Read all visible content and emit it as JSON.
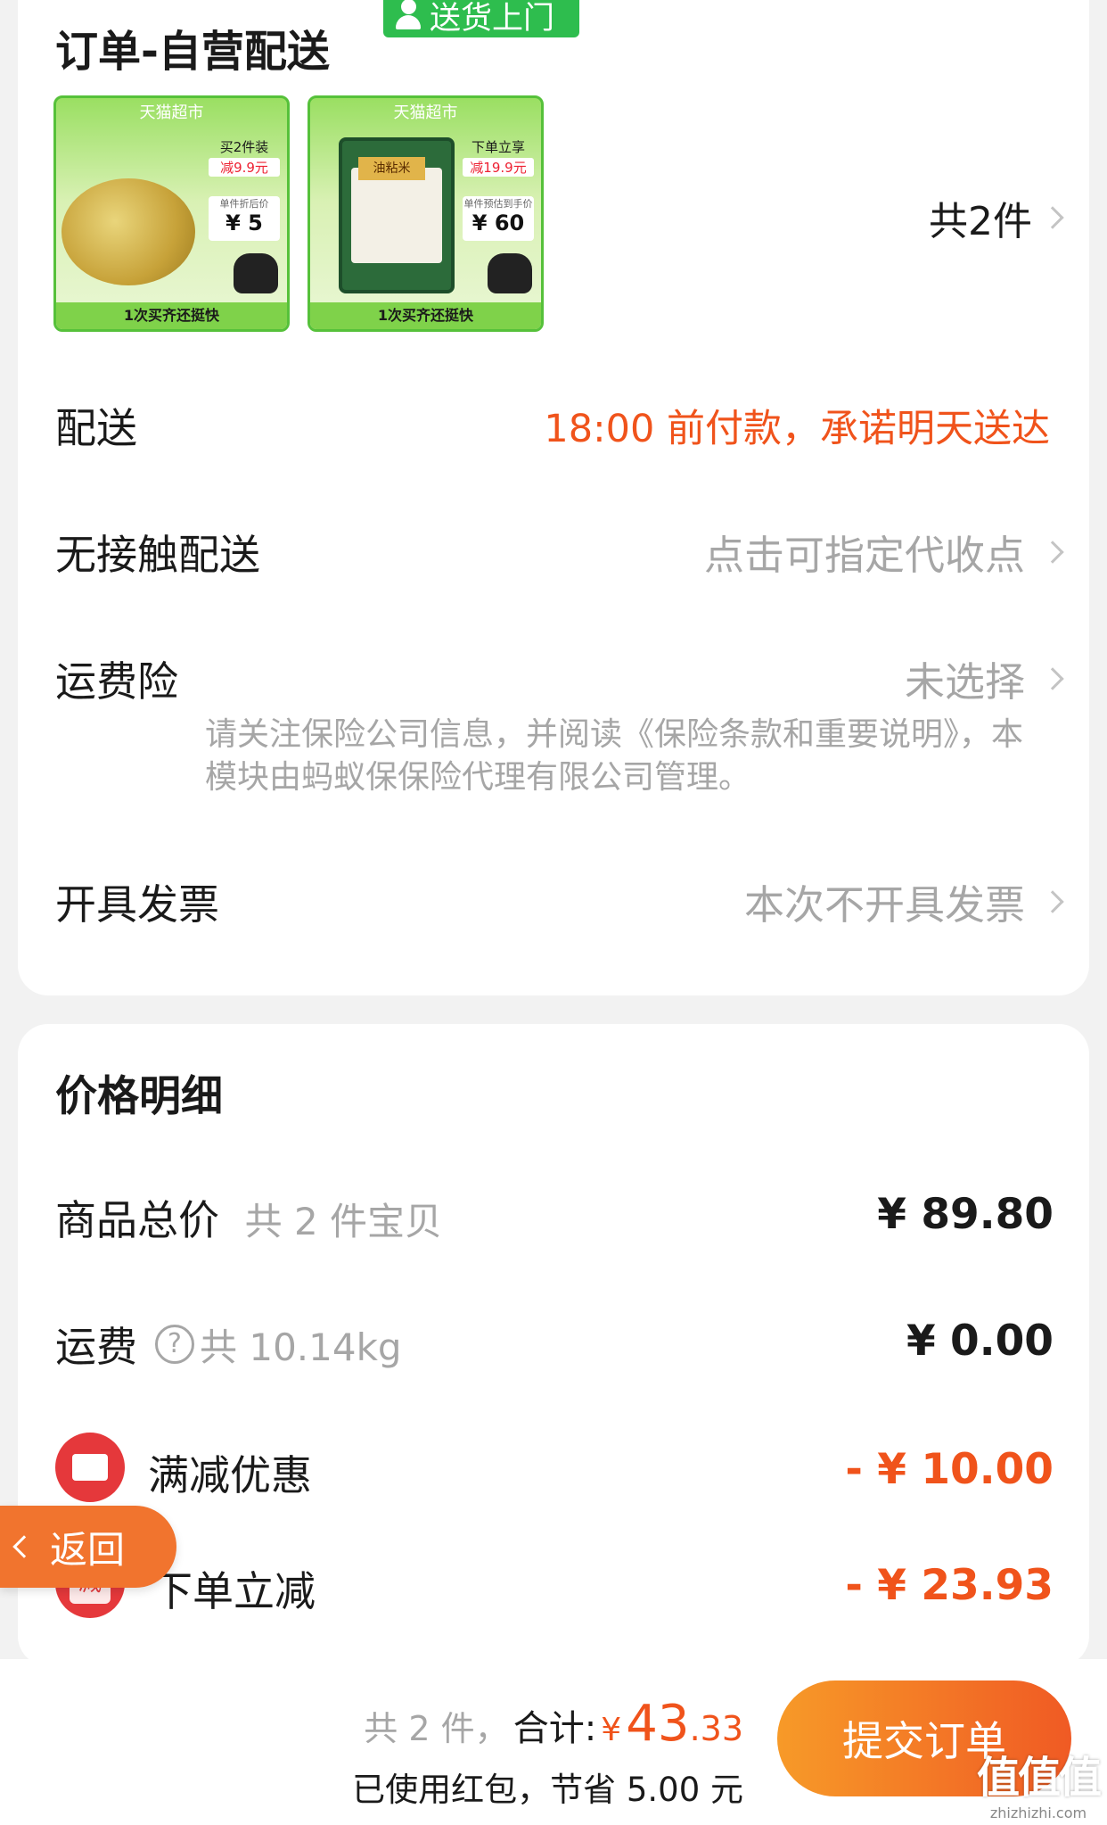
{
  "order": {
    "title": "订单-自营配送",
    "delivery_badge": "送货上门",
    "item_count": "共2件",
    "products": [
      {
        "store": "天猫超市",
        "promo_line1": "买2件装",
        "promo_line2": "减9.9元",
        "price_label": "单件折后价",
        "price": "¥ 5",
        "footer": "1次买齐还挺快"
      },
      {
        "store": "天猫超市",
        "promo_line1": "下单立享",
        "promo_line2": "减19.9元",
        "price_label": "单件预估到手价",
        "price": "¥ 60",
        "footer": "1次买齐还挺快",
        "bag_label": "油粘米"
      }
    ],
    "rows": {
      "delivery_label": "配送",
      "delivery_value": "18:00 前付款，承诺明天送达",
      "contactless_label": "无接触配送",
      "contactless_value": "点击可指定代收点",
      "insurance_label": "运费险",
      "insurance_value": "未选择",
      "insurance_note": "请关注保险公司信息，并阅读《保险条款和重要说明》，本模块由蚂蚁保保险代理有限公司管理。",
      "invoice_label": "开具发票",
      "invoice_value": "本次不开具发票"
    }
  },
  "price_detail": {
    "title": "价格明细",
    "goods_label": "商品总价",
    "goods_count": "共 2 件宝贝",
    "goods_value": "¥ 89.80",
    "shipping_label": "运费",
    "shipping_help": "?",
    "shipping_weight": "共 10.14kg",
    "shipping_value": "¥ 0.00",
    "discount_label": "满减优惠",
    "discount_value": "- ¥ 10.00",
    "instant_label": "下单立减",
    "instant_icon_text": "减",
    "instant_value": "- ¥ 23.93"
  },
  "back_button": "返回",
  "bottom_bar": {
    "count": "共 2 件，",
    "total_label": "合计:",
    "currency": "¥",
    "total_int": "43",
    "total_dec": ".33",
    "saving": "已使用红包，节省 5.00 元",
    "submit": "提交订单"
  },
  "watermark": {
    "logo": "值值值",
    "url": "zhizhizhi.com"
  },
  "colors": {
    "accent_orange": "#f0531b",
    "badge_green": "#2ebd4e",
    "coupon_red": "#e5383b",
    "muted_gray": "#a6a6a6"
  }
}
